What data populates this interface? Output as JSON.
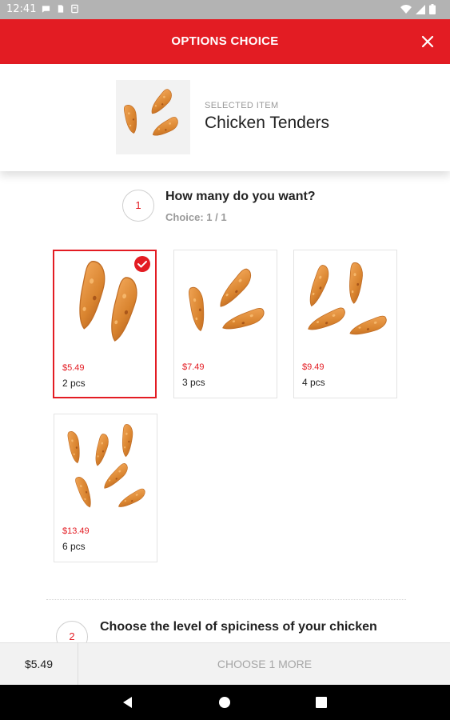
{
  "status_bar": {
    "time": "12:41",
    "left_icons": [
      "chat-icon",
      "sim-card-icon",
      "storage-icon"
    ],
    "right_icons": [
      "wifi-icon",
      "signal-icon",
      "battery-icon"
    ]
  },
  "header": {
    "title": "OPTIONS CHOICE",
    "close_icon": "close-icon",
    "color": "#e31c23"
  },
  "selected_item": {
    "label": "SELECTED ITEM",
    "name": "Chicken Tenders"
  },
  "steps": [
    {
      "number": "1",
      "title": "How many do you want?",
      "subtitle": "Choice: 1 / 1",
      "options": [
        {
          "price": "$5.49",
          "label": "2 pcs",
          "selected": true,
          "pieces": 2
        },
        {
          "price": "$7.49",
          "label": "3 pcs",
          "selected": false,
          "pieces": 3
        },
        {
          "price": "$9.49",
          "label": "4 pcs",
          "selected": false,
          "pieces": 4
        },
        {
          "price": "$13.49",
          "label": "6 pcs",
          "selected": false,
          "pieces": 6
        }
      ]
    },
    {
      "number": "2",
      "title": "Choose the level of spiciness of your chicken"
    }
  ],
  "footer": {
    "total": "$5.49",
    "action": "CHOOSE 1 MORE"
  },
  "nav": [
    "back-icon",
    "home-icon",
    "recents-icon"
  ],
  "colors": {
    "accent": "#e31c23",
    "muted": "#9a9a9a",
    "tender": "#d98a3c"
  }
}
